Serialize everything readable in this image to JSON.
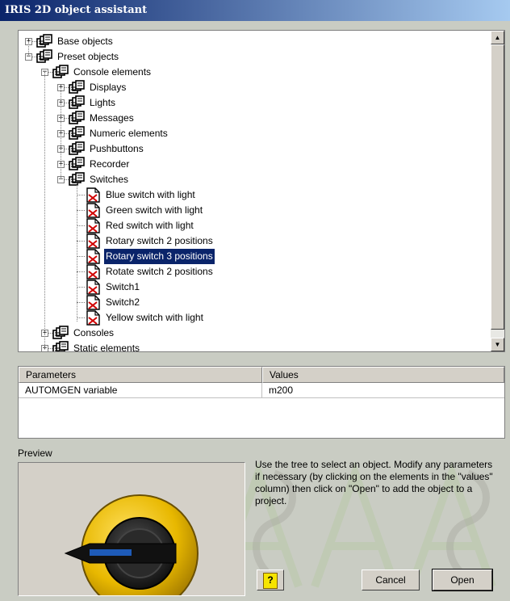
{
  "window": {
    "title": "IRIS 2D object assistant"
  },
  "tree": {
    "items": [
      {
        "label": "Base objects",
        "level": 0,
        "type": "folder",
        "expander": "+"
      },
      {
        "label": "Preset objects",
        "level": 0,
        "type": "folder",
        "expander": "-"
      },
      {
        "label": "Console elements",
        "level": 1,
        "type": "folder",
        "expander": "-"
      },
      {
        "label": "Displays",
        "level": 2,
        "type": "folder",
        "expander": "+"
      },
      {
        "label": "Lights",
        "level": 2,
        "type": "folder",
        "expander": "+"
      },
      {
        "label": "Messages",
        "level": 2,
        "type": "folder",
        "expander": "+"
      },
      {
        "label": "Numeric elements",
        "level": 2,
        "type": "folder",
        "expander": "+"
      },
      {
        "label": "Pushbuttons",
        "level": 2,
        "type": "folder",
        "expander": "+"
      },
      {
        "label": "Recorder",
        "level": 2,
        "type": "folder",
        "expander": "+"
      },
      {
        "label": "Switches",
        "level": 2,
        "type": "folder",
        "expander": "-"
      },
      {
        "label": "Blue switch with light",
        "level": 3,
        "type": "object"
      },
      {
        "label": "Green switch with light",
        "level": 3,
        "type": "object"
      },
      {
        "label": "Red switch with light",
        "level": 3,
        "type": "object"
      },
      {
        "label": "Rotary switch 2 positions",
        "level": 3,
        "type": "object"
      },
      {
        "label": "Rotary switch 3 positions",
        "level": 3,
        "type": "object",
        "selected": true
      },
      {
        "label": "Rotate switch 2 positions",
        "level": 3,
        "type": "object"
      },
      {
        "label": "Switch1",
        "level": 3,
        "type": "object"
      },
      {
        "label": "Switch2",
        "level": 3,
        "type": "object"
      },
      {
        "label": "Yellow switch with light",
        "level": 3,
        "type": "object"
      },
      {
        "label": "Consoles",
        "level": 1,
        "type": "folder",
        "expander": "+"
      },
      {
        "label": "Static elements",
        "level": 1,
        "type": "folder",
        "expander": "+"
      }
    ]
  },
  "parameters": {
    "col_parameters": "Parameters",
    "col_values": "Values",
    "rows": [
      {
        "parameter": "AUTOMGEN variable",
        "value": "m200"
      }
    ]
  },
  "preview": {
    "label": "Preview"
  },
  "help_text": "Use the tree to select an object. Modify any parameters if necessary (by clicking on the elements in the \"values\" column) then click on \"Open\" to add the object to a project.",
  "buttons": {
    "help_glyph": "?",
    "cancel": "Cancel",
    "open": "Open"
  },
  "colors": {
    "selection": "#0a246a",
    "knob_yellow": "#e8b800",
    "knob_dark": "#1a1a1a",
    "indicator_blue": "#1e5bb8"
  }
}
